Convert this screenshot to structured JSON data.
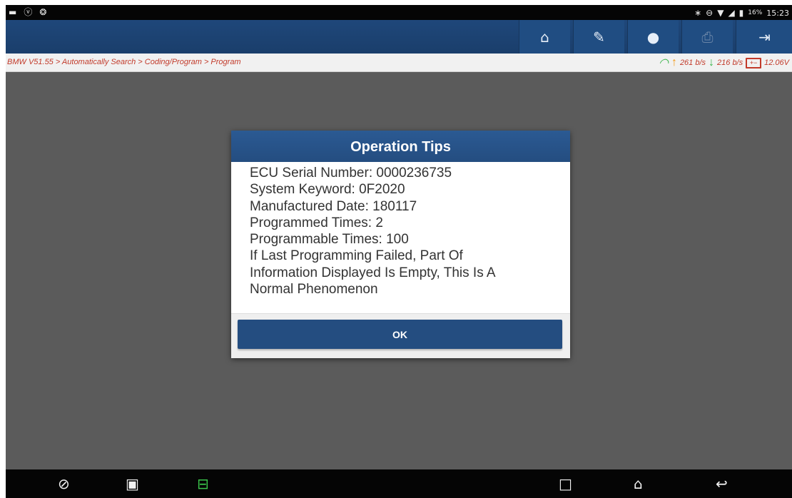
{
  "statusbar": {
    "left_icons": [
      "image-icon",
      "usb-icon",
      "touch-icon"
    ],
    "right_icons": [
      "bluetooth-icon",
      "do-not-disturb-icon",
      "wifi-icon",
      "signal-icon",
      "battery-icon"
    ],
    "battery_percent": "16%",
    "time": "15:23"
  },
  "toolbar": {
    "buttons": [
      "home-icon",
      "edit-icon",
      "message-icon",
      "print-icon",
      "exit-icon"
    ]
  },
  "breadcrumb": {
    "path": "BMW V51.55 > Automatically Search > Coding/Program > Program",
    "upload_rate": "261 b/s",
    "download_rate": "216 b/s",
    "voltage": "12.06V"
  },
  "dialog": {
    "title": "Operation Tips",
    "lines": [
      "ECU Serial Number: 0000236735",
      "System Keyword: 0F2020",
      "Manufactured Date: 180117",
      "Programmed Times: 2",
      "Programmable Times: 100",
      "If Last Programming Failed, Part Of",
      "Information Displayed Is Empty, This Is A",
      "Normal Phenomenon"
    ],
    "ok_label": "OK"
  },
  "navbar": {
    "icons": [
      "browser-icon",
      "gallery-icon",
      "vci-icon",
      "recents-icon",
      "home-icon",
      "back-icon"
    ],
    "vci_color": "#3ac44a"
  }
}
